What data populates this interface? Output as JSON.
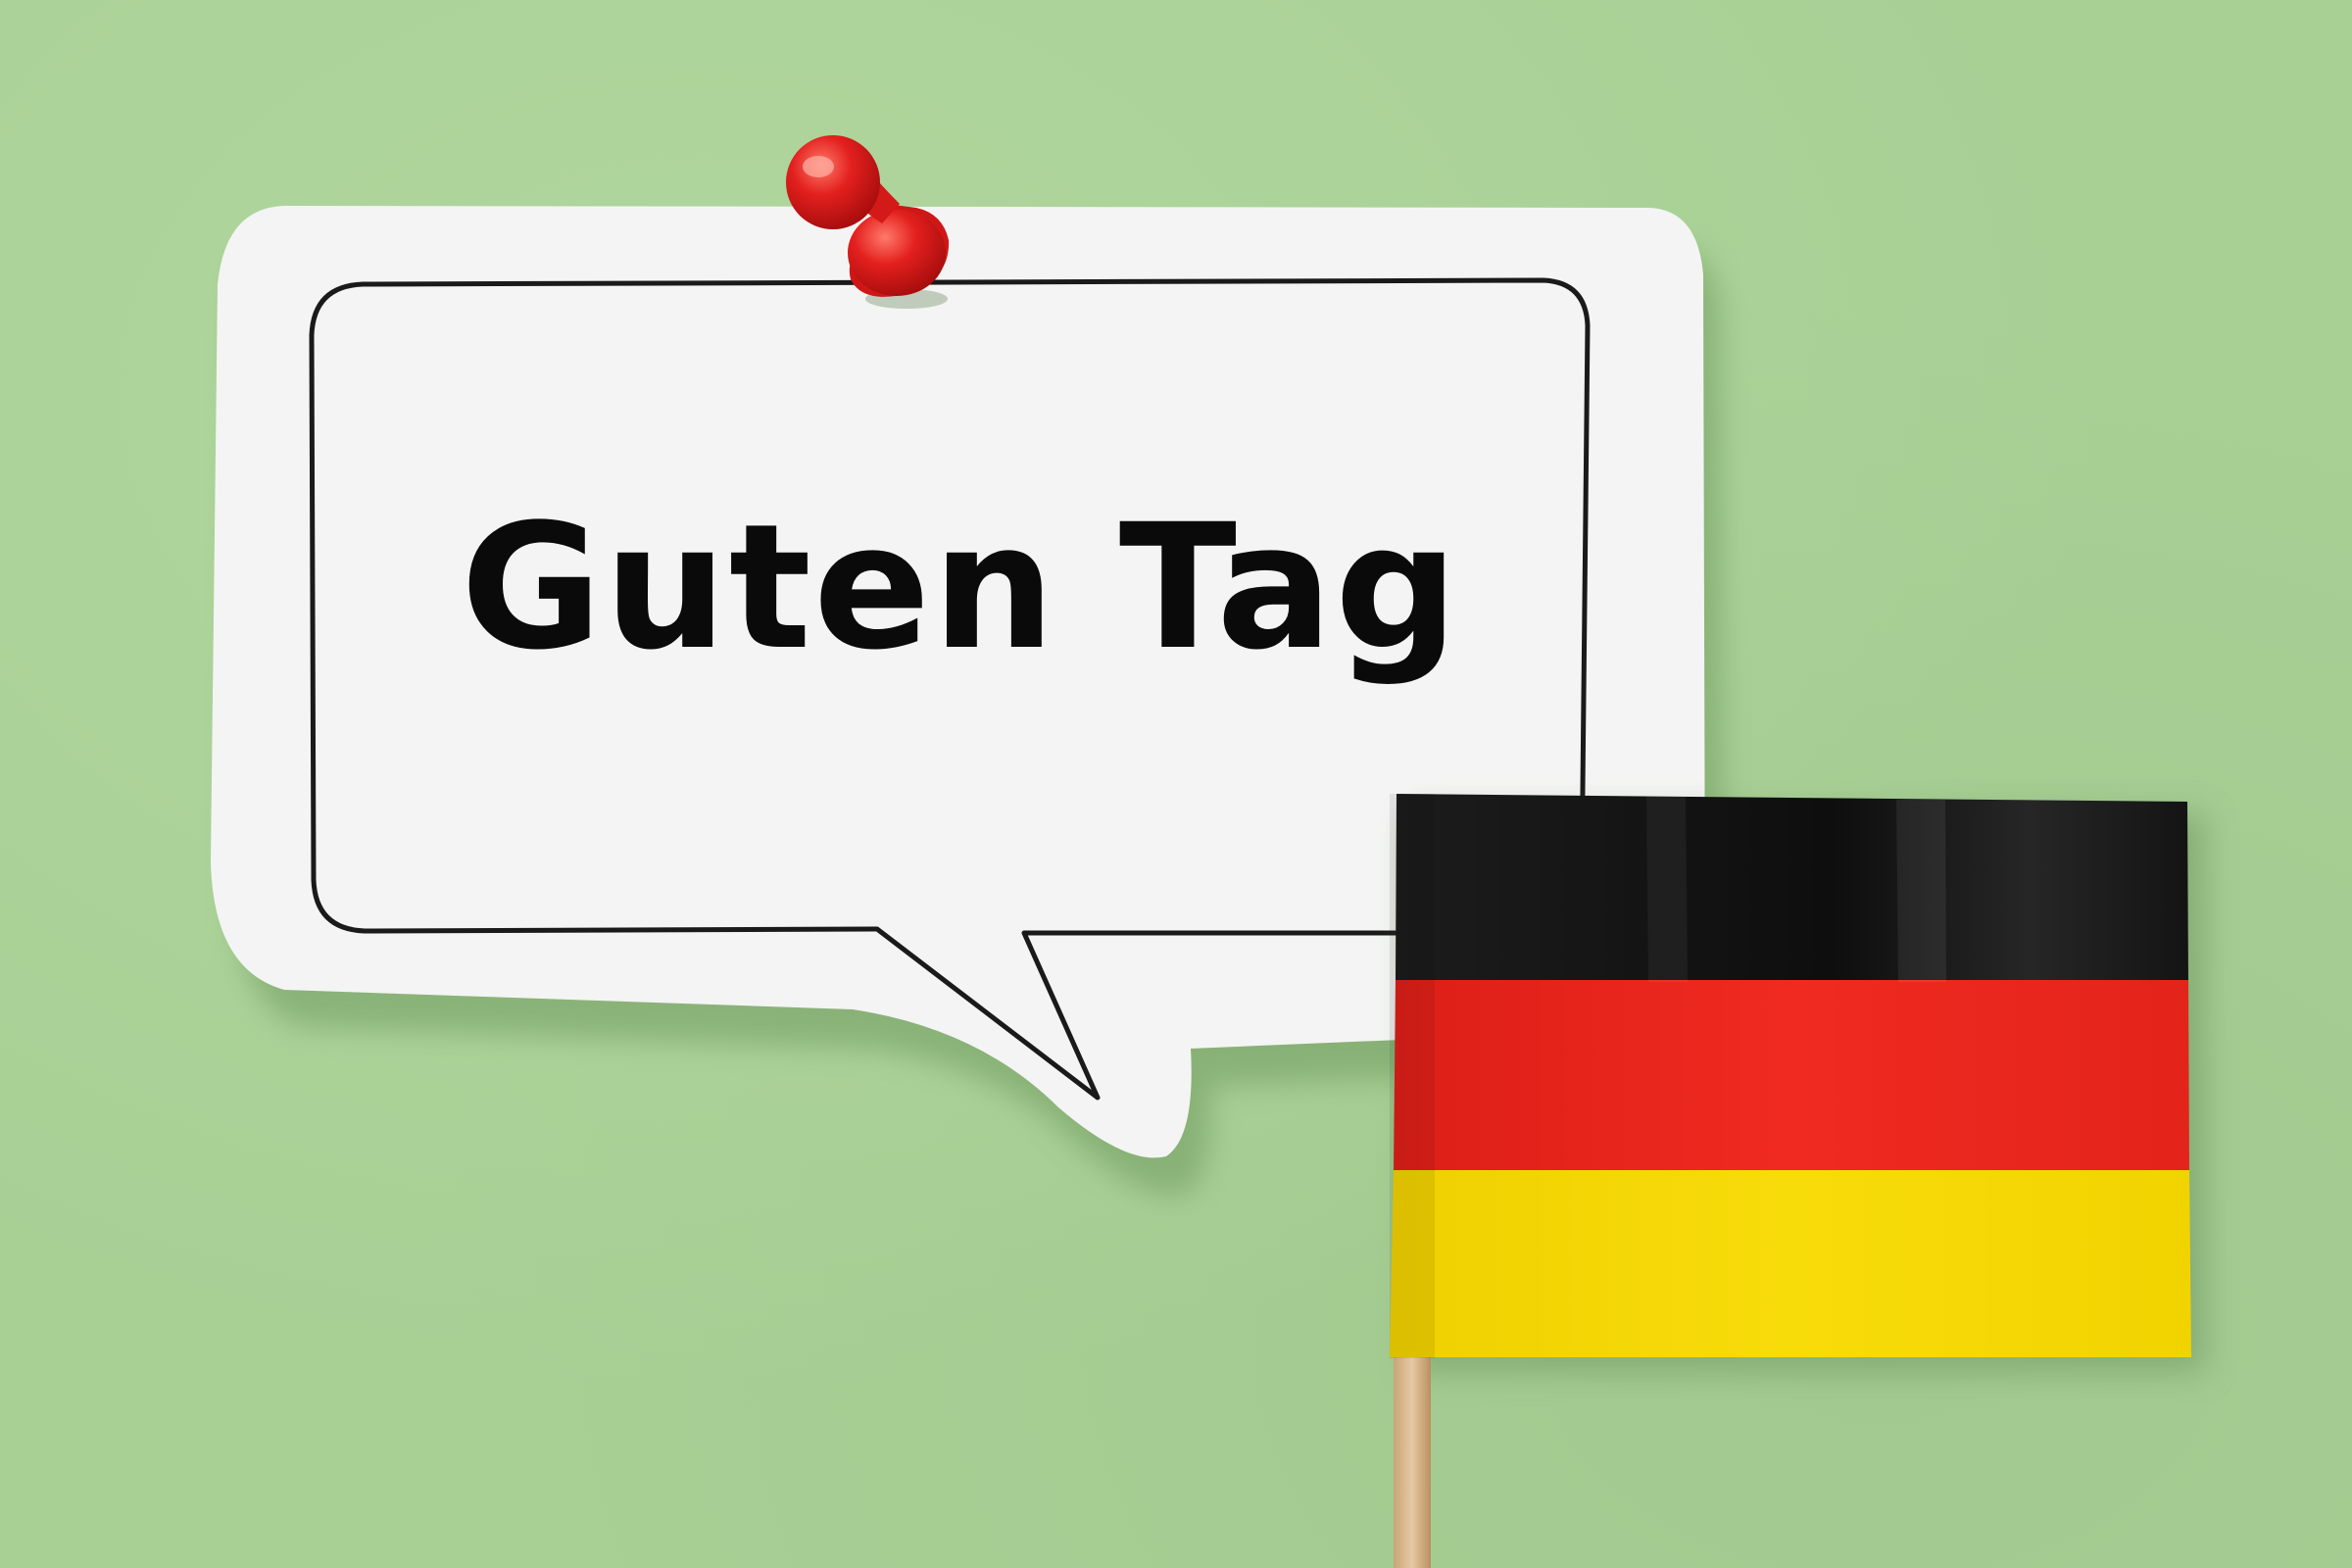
{
  "speech_bubble": {
    "text": "Guten Tag"
  },
  "flag": {
    "stripe_colors": [
      "#141414",
      "#e8231c",
      "#f5d800"
    ]
  },
  "colors": {
    "background": "#a8d095",
    "paper": "#f4f4f4",
    "pin": "#e3201e"
  }
}
